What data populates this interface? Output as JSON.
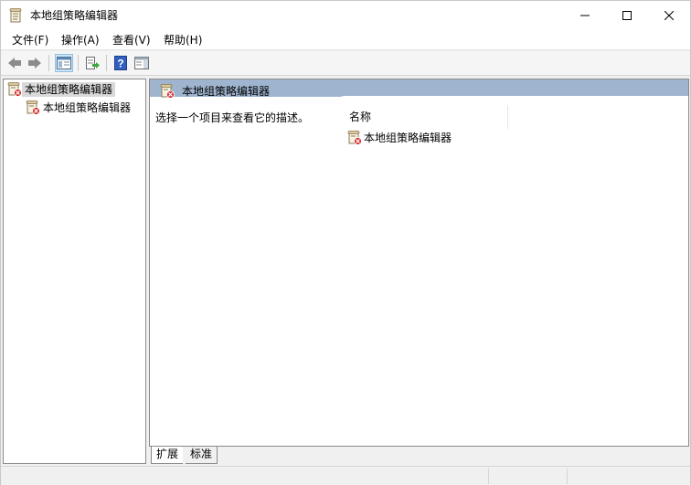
{
  "window": {
    "title": "本地组策略编辑器",
    "controls": {
      "minimize_icon": "minimize-icon",
      "maximize_icon": "maximize-icon",
      "close_icon": "close-icon"
    }
  },
  "menu": {
    "items": [
      "文件(F)",
      "操作(A)",
      "查看(V)",
      "帮助(H)"
    ]
  },
  "toolbar": {
    "buttons": [
      "back-arrow-icon",
      "forward-arrow-icon",
      "show-hide-console-tree-icon",
      "export-list-icon",
      "help-icon",
      "show-hide-action-pane-icon"
    ]
  },
  "tree": {
    "root": {
      "label": "本地组策略编辑器",
      "icon": "policy-editor-icon",
      "selected": true
    },
    "child": {
      "label": "本地组策略编辑器",
      "icon": "policy-editor-icon"
    }
  },
  "details": {
    "header_title": "本地组策略编辑器",
    "description": "选择一个项目来查看它的描述。",
    "column_name": "名称",
    "items": [
      {
        "label": "本地组策略编辑器",
        "icon": "policy-editor-icon"
      }
    ]
  },
  "tabs": {
    "extended": "扩展",
    "standard": "标准"
  },
  "colors": {
    "header_bar": "#9fb5cf",
    "selection": "#d9d9d9",
    "toolbar_active": "#cde6f7"
  }
}
